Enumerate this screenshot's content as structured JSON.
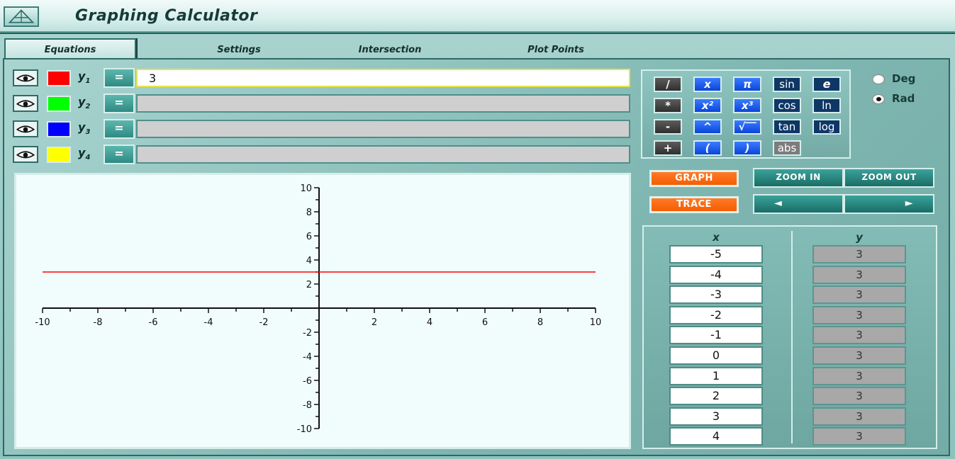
{
  "app": {
    "title": "Graphing Calculator"
  },
  "tabs": [
    {
      "label": "Equations"
    },
    {
      "label": "Settings"
    },
    {
      "label": "Intersection"
    },
    {
      "label": "Plot Points"
    }
  ],
  "equations": [
    {
      "label": "y",
      "sub": "1",
      "color": "#ff0000",
      "button": "=",
      "value": "3"
    },
    {
      "label": "y",
      "sub": "2",
      "color": "#00ff00",
      "button": "=",
      "value": ""
    },
    {
      "label": "y",
      "sub": "3",
      "color": "#0000ff",
      "button": "=",
      "value": ""
    },
    {
      "label": "y",
      "sub": "4",
      "color": "#ffff00",
      "button": "=",
      "value": ""
    }
  ],
  "keypad": {
    "keys": [
      [
        "/",
        "x",
        "π",
        "sin",
        "e"
      ],
      [
        "*",
        "x²",
        "x³",
        "cos",
        "ln"
      ],
      [
        "-",
        "^",
        "√‾‾",
        "tan",
        "log"
      ],
      [
        "+",
        "(",
        ")",
        "abs"
      ]
    ]
  },
  "angle_mode": {
    "deg": "Deg",
    "rad": "Rad",
    "selected": "Rad"
  },
  "actions": {
    "graph": "GRAPH",
    "trace": "TRACE",
    "zoom_in": "ZOOM IN",
    "zoom_out": "ZOOM OUT",
    "left_arrow": "◄",
    "right_arrow": "►"
  },
  "table": {
    "x_header": "x",
    "y_header": "y",
    "rows": [
      {
        "x": "-5",
        "y": "3"
      },
      {
        "x": "-4",
        "y": "3"
      },
      {
        "x": "-3",
        "y": "3"
      },
      {
        "x": "-2",
        "y": "3"
      },
      {
        "x": "-1",
        "y": "3"
      },
      {
        "x": "0",
        "y": "3"
      },
      {
        "x": "1",
        "y": "3"
      },
      {
        "x": "2",
        "y": "3"
      },
      {
        "x": "3",
        "y": "3"
      },
      {
        "x": "4",
        "y": "3"
      }
    ]
  },
  "chart_data": {
    "type": "line",
    "title": "",
    "xlabel": "",
    "ylabel": "",
    "xlim": [
      -10,
      10
    ],
    "ylim": [
      -10,
      10
    ],
    "x_ticks": [
      -10,
      -8,
      -6,
      -4,
      -2,
      2,
      4,
      6,
      8,
      10
    ],
    "y_ticks": [
      10,
      8,
      6,
      4,
      2,
      -2,
      -4,
      -6,
      -8,
      -10
    ],
    "series": [
      {
        "color": "#ff0000",
        "x": [
          -10,
          10
        ],
        "y": [
          3,
          3
        ]
      }
    ],
    "grid": false
  }
}
